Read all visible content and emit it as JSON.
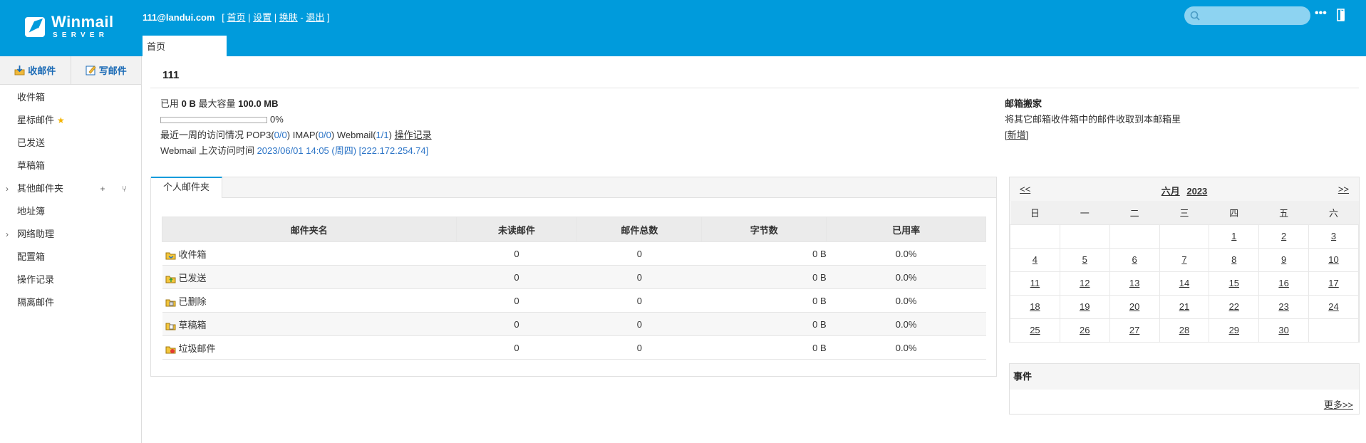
{
  "header": {
    "logo_name": "Winmail",
    "logo_sub": "SERVER",
    "user_email": "111@landui.com",
    "links": {
      "home": "首页",
      "settings": "设置",
      "skin": "换肤",
      "logout": "退出"
    },
    "bracket_open": "[",
    "bracket_close": "]",
    "sep1": "|",
    "sep2": "|",
    "sep3": "-",
    "search_placeholder": "",
    "more_label": "•••",
    "tab_home": "首页"
  },
  "sidebar": {
    "receive_label": "收邮件",
    "compose_label": "写邮件",
    "items": [
      {
        "label": "收件箱"
      },
      {
        "label": "星标邮件"
      },
      {
        "label": "已发送"
      },
      {
        "label": "草稿箱"
      },
      {
        "label": "其他邮件夹"
      },
      {
        "label": "地址簿"
      },
      {
        "label": "网络助理"
      },
      {
        "label": "配置箱"
      },
      {
        "label": "操作记录"
      },
      {
        "label": "隔离邮件"
      }
    ],
    "folder_ops": "+ ⑂",
    "expand_caret": "›"
  },
  "main": {
    "username": "111",
    "quota": {
      "used_label": "已用",
      "used_value": "0 B",
      "max_label": "最大容量",
      "max_value": "100.0 MB",
      "percent_text": "0%",
      "percent_fraction": 0.0
    },
    "access": {
      "label": "最近一周的访问情况",
      "pop3_label": "POP3(",
      "pop3_value": "0/0",
      "imap_label": "IMAP(",
      "imap_value": "0/0",
      "webmail_label": "Webmail(",
      "webmail_value": "1/1",
      "close_paren": ")",
      "log_link": "操作记录"
    },
    "last_visit": {
      "label": "Webmail 上次访问时间",
      "value": "2023/06/01 14:05 (周四) [222.172.254.74]"
    },
    "migrate": {
      "title": "邮箱搬家",
      "desc": "将其它邮箱收件箱中的邮件收取到本邮箱里",
      "add_link": "[新增]"
    }
  },
  "folders": {
    "tab": "个人邮件夹",
    "columns": [
      "邮件夹名",
      "未读邮件",
      "邮件总数",
      "字节数",
      "已用率"
    ],
    "rows": [
      {
        "name": "收件箱",
        "unread": "0",
        "total": "0",
        "bytes": "0 B",
        "rate": "0.0%",
        "icon": "inbox-folder-icon"
      },
      {
        "name": "已发送",
        "unread": "0",
        "total": "0",
        "bytes": "0 B",
        "rate": "0.0%",
        "icon": "sent-folder-icon"
      },
      {
        "name": "已删除",
        "unread": "0",
        "total": "0",
        "bytes": "0 B",
        "rate": "0.0%",
        "icon": "deleted-folder-icon"
      },
      {
        "name": "草稿箱",
        "unread": "0",
        "total": "0",
        "bytes": "0 B",
        "rate": "0.0%",
        "icon": "drafts-folder-icon"
      },
      {
        "name": "垃圾邮件",
        "unread": "0",
        "total": "0",
        "bytes": "0 B",
        "rate": "0.0%",
        "icon": "junk-folder-icon"
      }
    ]
  },
  "calendar": {
    "prev": "<<",
    "next": ">>",
    "month": "六月",
    "year": "2023",
    "weekdays": [
      "日",
      "一",
      "二",
      "三",
      "四",
      "五",
      "六"
    ],
    "weeks": [
      [
        "",
        "",
        "",
        "",
        "1",
        "2",
        "3"
      ],
      [
        "4",
        "5",
        "6",
        "7",
        "8",
        "9",
        "10"
      ],
      [
        "11",
        "12",
        "13",
        "14",
        "15",
        "16",
        "17"
      ],
      [
        "18",
        "19",
        "20",
        "21",
        "22",
        "23",
        "24"
      ],
      [
        "25",
        "26",
        "27",
        "28",
        "29",
        "30",
        ""
      ]
    ]
  },
  "events": {
    "title": "事件",
    "more": "更多>>"
  },
  "colors": {
    "header_blue": "#009bdc",
    "link_blue": "#2a73c6",
    "action_blue": "#1a6ab5"
  }
}
